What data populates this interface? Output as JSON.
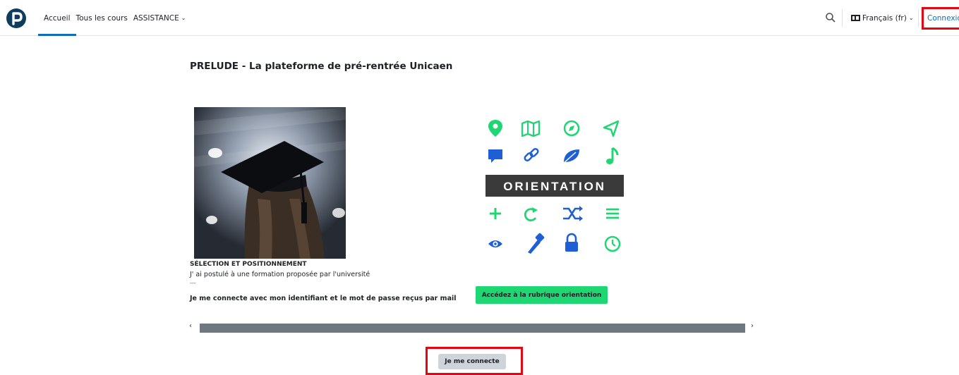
{
  "navbar": {
    "nav_items": [
      {
        "label": "Accueil",
        "active": true
      },
      {
        "label": "Tous les cours",
        "active": false
      },
      {
        "label": "ASSISTANCE",
        "has_dropdown": true
      }
    ],
    "language_label": "Français (fr)",
    "login_label": "Connexion",
    "icons": [
      "logo-icon",
      "search-icon",
      "language-icon",
      "chevron-down-icon"
    ]
  },
  "main": {
    "title": "PRELUDE - La plateforme de pré-rentrée Unicaen",
    "card_left": {
      "caption_title": "SÉLECTION ET POSITIONNEMENT",
      "caption_text": "J' ai postulé à une formation proposée par l'université",
      "caption_separator": "---",
      "caption_bold": "Je me connecte avec mon  identifiant et le mot de passe  reçus par mail"
    },
    "card_right": {
      "banner_text": "ORIENTATION",
      "button_label": "Accédez à la rubrique orientation",
      "icon_names": [
        "map-pin-icon",
        "map-icon",
        "compass-icon",
        "navigation-arrow-icon",
        "chat-bubble-icon",
        "link-icon",
        "leaf-icon",
        "music-note-icon",
        "plus-icon",
        "refresh-icon",
        "shuffle-icon",
        "menu-lines-icon",
        "eye-icon",
        "flashlight-icon",
        "lock-icon",
        "clock-icon"
      ]
    },
    "carousel": {
      "prev_label": "‹",
      "next_label": "›"
    },
    "connect_button_label": "Je me connecte"
  },
  "colors": {
    "accent_blue": "#0f6cbf",
    "highlight_red": "#e30613",
    "icon_green": "#1ed672",
    "icon_blue": "#1f5fd6",
    "banner_dark": "#3a3a3a",
    "scrollbar": "#6e7880",
    "button_grey": "#ced4da"
  }
}
